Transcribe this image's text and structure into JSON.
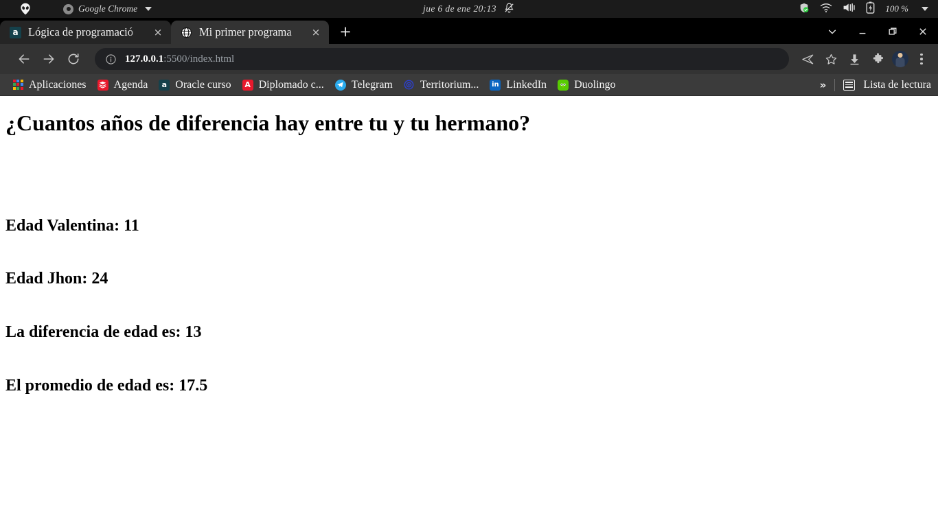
{
  "system_bar": {
    "logo_icon": "alien-head-icon",
    "app_name": "Google Chrome",
    "app_icon": "chrome-icon",
    "app_menu_caret": "caret-down-icon",
    "clock": "jue  6 de ene  20:13",
    "notifications_icon": "bell-muted-icon",
    "status_icons": [
      "shield-check-icon",
      "wifi-icon",
      "volume-icon",
      "battery-charging-icon"
    ],
    "battery_percent": "100 %",
    "system_menu_caret": "caret-down-icon"
  },
  "tabs": [
    {
      "title": "Lógica de programació",
      "favicon": "alura-a-icon",
      "favicon_letter": "a",
      "active": false,
      "close_label": "×"
    },
    {
      "title": "Mi primer programa",
      "favicon": "globe-icon",
      "favicon_letter": "",
      "active": true,
      "close_label": "×"
    }
  ],
  "new_tab_label": "+",
  "window_controls": {
    "tab_search": "chevron-down-icon",
    "minimize": "minimize-icon",
    "maximize": "maximize-icon",
    "close": "close-icon"
  },
  "toolbar": {
    "back_icon": "arrow-back-icon",
    "forward_icon": "arrow-forward-icon",
    "reload_icon": "reload-icon",
    "site_info_icon": "info-circle-icon",
    "url_host": "127.0.0.1",
    "url_path": ":5500/index.html",
    "url_full": "127.0.0.1:5500/index.html",
    "share_icon": "share-send-icon",
    "bookmark_icon": "star-icon",
    "downloads_icon": "download-icon",
    "extensions_icon": "puzzle-icon",
    "profile_icon": "avatar-photo",
    "menu_icon": "three-dots-icon"
  },
  "bookmarks": {
    "items": [
      {
        "label": "Aplicaciones",
        "icon": "apps-grid-icon",
        "letter": ""
      },
      {
        "label": "Agenda",
        "icon": "agenda-icon",
        "letter": ""
      },
      {
        "label": "Oracle curso",
        "icon": "alura-a-icon",
        "letter": "a"
      },
      {
        "label": "Diplomado c...",
        "icon": "alura-icon",
        "letter": "A"
      },
      {
        "label": "Telegram",
        "icon": "telegram-icon",
        "letter": ""
      },
      {
        "label": "Territorium...",
        "icon": "territorium-icon",
        "letter": ""
      },
      {
        "label": "LinkedIn",
        "icon": "linkedin-icon",
        "letter": "in"
      },
      {
        "label": "Duolingo",
        "icon": "duolingo-owl-icon",
        "letter": ""
      }
    ],
    "overflow_label": "»",
    "reading_list_label": "Lista de lectura",
    "reading_list_icon": "reading-list-icon"
  },
  "page": {
    "heading": "¿Cuantos años de diferencia hay entre tu y tu hermano?",
    "line_valentina": "Edad Valentina: 11",
    "line_jhon": "Edad Jhon: 24",
    "line_difference": "La diferencia de edad es: 13",
    "line_average": "El promedio de edad es: 17.5"
  },
  "colors": {
    "system_bar_bg": "#1b1b1b",
    "tabstrip_bg": "#000000",
    "active_tab_bg": "#333333",
    "inactive_tab_bg": "#252525",
    "toolbar_bg": "#333333",
    "omnibox_bg": "#202124",
    "bookmarks_bg": "#3b3b3b",
    "page_bg": "#ffffff",
    "text_primary": "#f3f3f3",
    "url_host": "#ffffff",
    "url_path": "#9aa0a6"
  }
}
